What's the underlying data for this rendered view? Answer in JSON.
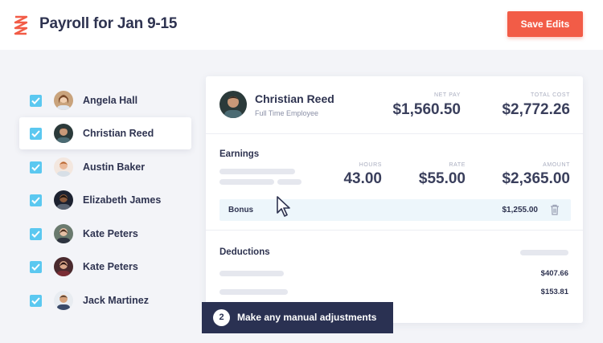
{
  "header": {
    "title": "Payroll for Jan 9-15",
    "save_label": "Save Edits",
    "logo_icon": "zigzag-logo",
    "accent_color": "#f25c47"
  },
  "employees": [
    {
      "name": "Angela Hall",
      "checked": true,
      "selected": false
    },
    {
      "name": "Christian Reed",
      "checked": true,
      "selected": true
    },
    {
      "name": "Austin Baker",
      "checked": true,
      "selected": false
    },
    {
      "name": "Elizabeth James",
      "checked": true,
      "selected": false
    },
    {
      "name": "Kate Peters",
      "checked": true,
      "selected": false
    },
    {
      "name": "Kate Peters",
      "checked": true,
      "selected": false
    },
    {
      "name": "Jack Martinez",
      "checked": true,
      "selected": false
    }
  ],
  "detail": {
    "name": "Christian Reed",
    "employment_type": "Full Time Employee",
    "net_pay_label": "NET PAY",
    "net_pay": "$1,560.50",
    "total_cost_label": "TOTAL COST",
    "total_cost": "$2,772.26",
    "earnings": {
      "title": "Earnings",
      "hours_label": "HOURS",
      "hours": "43.00",
      "rate_label": "RATE",
      "rate": "$55.00",
      "amount_label": "AMOUNT",
      "amount": "$2,365.00",
      "bonus_label": "Bonus",
      "bonus_amount": "$1,255.00"
    },
    "deductions": {
      "title": "Deductions",
      "amounts": [
        "$407.66",
        "$153.81"
      ]
    }
  },
  "step": {
    "number": "2",
    "text": "Make any manual adjustments"
  }
}
